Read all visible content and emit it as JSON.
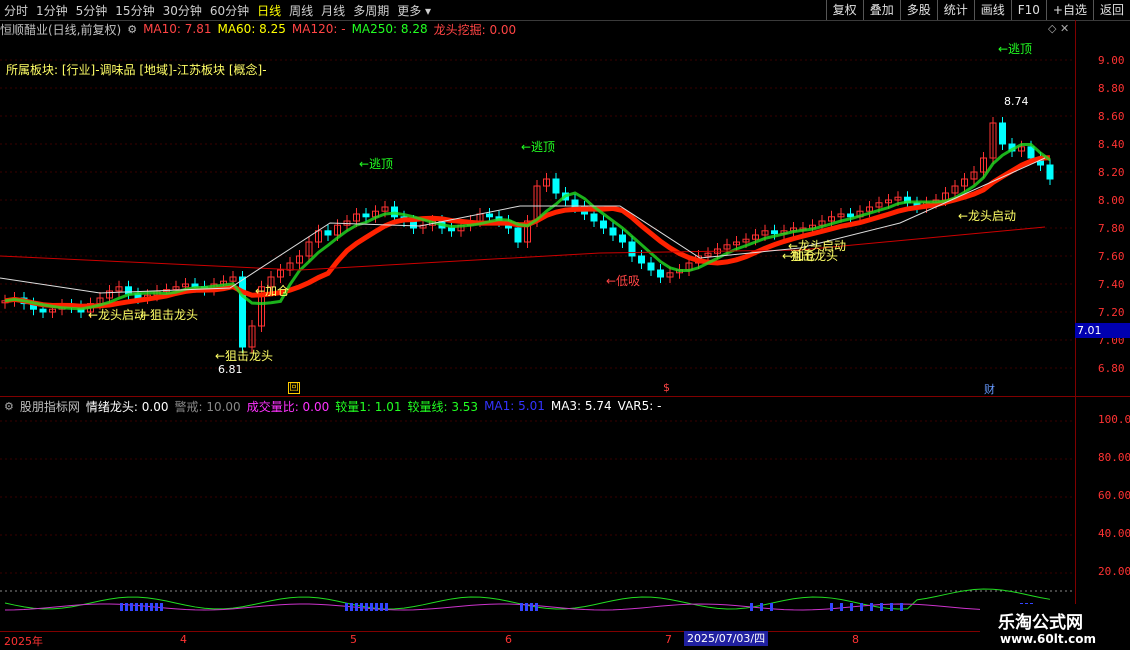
{
  "toolbar": {
    "periods": [
      "分时",
      "1分钟",
      "5分钟",
      "15分钟",
      "30分钟",
      "60分钟",
      "日线",
      "周线",
      "月线",
      "多周期",
      "更多 ▾"
    ],
    "active_period": "日线",
    "right_buttons": [
      "复权",
      "叠加",
      "多股",
      "统计",
      "画线",
      "F10",
      "+自选",
      "返回"
    ]
  },
  "info": {
    "title": "恒顺醋业(日线,前复权)",
    "ma10": "MA10: 7.81",
    "ma60": "MA60: 8.25",
    "ma120": "MA120: -",
    "ma250": "MA250: 8.28",
    "longtou": "龙头挖掘: 0.00"
  },
  "sector_text": "所属板块: [行业]-调味品 [地域]-江苏板块 [概念]-",
  "price_axis": [
    "9.00",
    "8.80",
    "8.60",
    "8.40",
    "8.20",
    "8.00",
    "7.80",
    "7.60",
    "7.40",
    "7.20",
    "7.00",
    "6.80"
  ],
  "price_tag": "7.01",
  "annotations": {
    "taoding1": "←逃顶",
    "taoding2": "←逃顶",
    "taoding3": "←逃顶",
    "high": "8.74",
    "low": "6.81",
    "zuji1": "←狙击龙头",
    "zuji2": "←狙击龙头",
    "jiacang": "←加仓",
    "dixi": "←低吸",
    "qidong1": "←龙头启动",
    "qidong2": "←龙头启动",
    "jiacang2": "←加仓",
    "zuji3": "狙击龙头",
    "qidong3": "←龙头启动"
  },
  "markers": {
    "m1": "回",
    "m2": "$",
    "m3": "财"
  },
  "indicator": {
    "name": "股朋指标网",
    "qingxu": "情绪龙头: 0.00",
    "jingjie": "警戒: 10.00",
    "chengjiao": "成交量比: 0.00",
    "jiaoliang1": "较量1: 1.01",
    "jiaoliangxian": "较量线: 3.53",
    "ma1": "MA1: 5.01",
    "ma3": "MA3: 5.74",
    "var5": "VAR5: -"
  },
  "ind_axis": [
    "100.0",
    "80.00",
    "60.00",
    "40.00",
    "20.00"
  ],
  "dates": [
    "2025年",
    "4",
    "5",
    "6",
    "7",
    "8"
  ],
  "selected_date": "2025/07/03/四",
  "watermark": {
    "name": "乐淘公式网",
    "url": "www.60lt.com"
  },
  "colors": {
    "up": "#ff3333",
    "down": "#00ffff",
    "ma_red": "#ff2200",
    "ma_green": "#22dd22",
    "yellow": "#ffff00"
  }
}
